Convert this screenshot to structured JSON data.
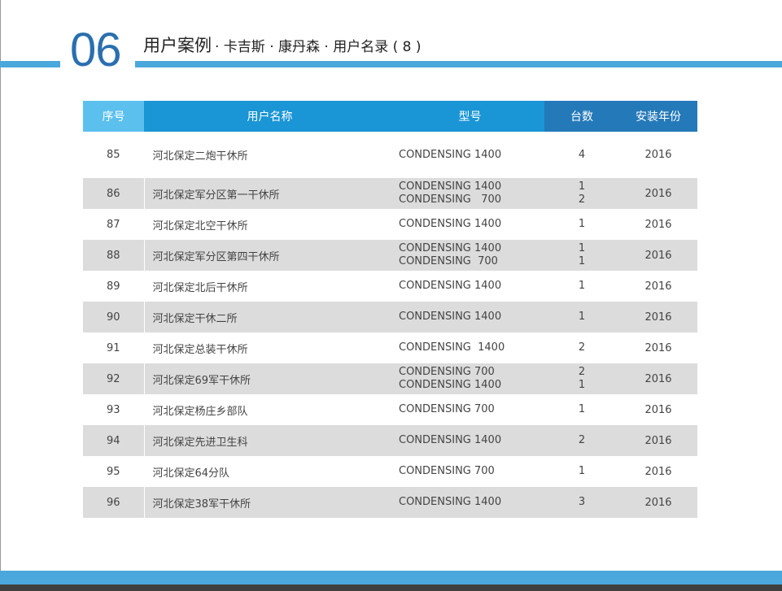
{
  "header": {
    "section_number": "06",
    "title_main": "用户案例",
    "title_sub": "· 卡吉斯 · 康丹森 · 用户名录 ( 8 )"
  },
  "table": {
    "columns": [
      "序号",
      "用户名称",
      "型号",
      "台数",
      "安装年份"
    ],
    "rows": [
      {
        "no": "85",
        "name": "河北保定二炮干休所",
        "models": [
          "CONDENSING 1400"
        ],
        "qty": [
          "4"
        ],
        "year": "2016"
      },
      {
        "no": "86",
        "name": "河北保定军分区第一干休所",
        "models": [
          "CONDENSING 1400",
          "CONDENSING   700"
        ],
        "qty": [
          "1",
          "2"
        ],
        "year": "2016"
      },
      {
        "no": "87",
        "name": "河北保定北空干休所",
        "models": [
          "CONDENSING 1400"
        ],
        "qty": [
          "1"
        ],
        "year": "2016"
      },
      {
        "no": "88",
        "name": "河北保定军分区第四干休所",
        "models": [
          "CONDENSING 1400",
          "CONDENSING  700"
        ],
        "qty": [
          "1",
          "1"
        ],
        "year": "2016"
      },
      {
        "no": "89",
        "name": "河北保定北后干休所",
        "models": [
          "CONDENSING 1400"
        ],
        "qty": [
          "1"
        ],
        "year": "2016"
      },
      {
        "no": "90",
        "name": "河北保定干休二所",
        "models": [
          "CONDENSING 1400"
        ],
        "qty": [
          "1"
        ],
        "year": "2016"
      },
      {
        "no": "91",
        "name": "河北保定总装干休所",
        "models": [
          "CONDENSING  1400"
        ],
        "qty": [
          "2"
        ],
        "year": "2016"
      },
      {
        "no": "92",
        "name": "河北保定69军干休所",
        "models": [
          "CONDENSING 700",
          "CONDENSING 1400"
        ],
        "qty": [
          "2",
          "1"
        ],
        "year": "2016"
      },
      {
        "no": "93",
        "name": "河北保定杨庄乡部队",
        "models": [
          "CONDENSING 700"
        ],
        "qty": [
          "1"
        ],
        "year": "2016"
      },
      {
        "no": "94",
        "name": "河北保定先进卫生科",
        "models": [
          "CONDENSING 1400"
        ],
        "qty": [
          "2"
        ],
        "year": "2016"
      },
      {
        "no": "95",
        "name": "河北保定64分队",
        "models": [
          "CONDENSING 700"
        ],
        "qty": [
          "1"
        ],
        "year": "2016"
      },
      {
        "no": "96",
        "name": "河北保定38军干休所",
        "models": [
          "CONDENSING 1400"
        ],
        "qty": [
          "3"
        ],
        "year": "2016"
      }
    ]
  },
  "colors": {
    "accent_blue": "#4aa8dc",
    "number_blue": "#2a6faf",
    "row_alt": "#dcdcdc"
  }
}
